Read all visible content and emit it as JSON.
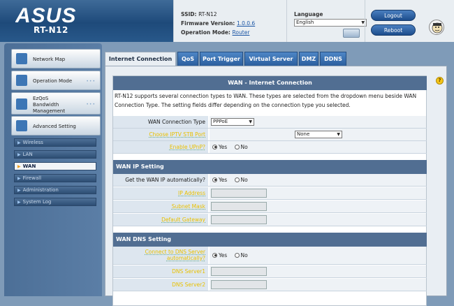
{
  "header": {
    "logo_text": "ASUS",
    "model": "RT-N12",
    "ssid_label": "SSID:",
    "ssid_value": "RT-N12",
    "firmware_label": "Firmware Version:",
    "firmware_value": "1.0.0.6",
    "mode_label": "Operation Mode:",
    "mode_value": "Router",
    "language_label": "Language",
    "language_value": "English",
    "logout_label": "Logout",
    "reboot_label": "Reboot"
  },
  "sidebar": {
    "main_items": [
      {
        "label": "Network Map",
        "icon": "network-map-icon"
      },
      {
        "label": "Operation Mode",
        "icon": "operation-mode-icon"
      },
      {
        "label": "EzQoS Bandwidth Management",
        "icon": "ezqos-icon"
      },
      {
        "label": "Advanced Setting",
        "icon": "advanced-setting-icon"
      }
    ],
    "sub_items": [
      {
        "label": "Wireless",
        "active": false
      },
      {
        "label": "LAN",
        "active": false
      },
      {
        "label": "WAN",
        "active": true
      },
      {
        "label": "Firewall",
        "active": false
      },
      {
        "label": "Administration",
        "active": false
      },
      {
        "label": "System Log",
        "active": false
      }
    ]
  },
  "tabs": [
    "Internet Connection",
    "QoS",
    "Port Trigger",
    "Virtual Server",
    "DMZ",
    "DDNS"
  ],
  "panel": {
    "title": "WAN - Internet Connection",
    "intro": "RT-N12 supports several connection types to WAN. These types are selected from the dropdown menu beside WAN Connection Type. The setting fields differ depending on the connection type you selected.",
    "wan_type_label": "WAN Connection Type",
    "wan_type_value": "PPPoE",
    "iptv_label": "Choose IPTV STB Port",
    "iptv_value": "None",
    "upnp_label": "Enable UPnP?",
    "yes": "Yes",
    "no": "No",
    "wan_ip_section": "WAN IP Setting",
    "auto_ip_label": "Get the WAN IP automatically?",
    "ip_label": "IP Address",
    "mask_label": "Subnet Mask",
    "gateway_label": "Default Gateway",
    "dns_section": "WAN DNS Setting",
    "dns_auto_label_1": "Connect to DNS Server",
    "dns_auto_label_2": "automatically?",
    "dns1_label": "DNS Server1",
    "dns2_label": "DNS Server2"
  },
  "colors": {
    "accent": "#516e92",
    "highlight_label": "#e8c000",
    "help_icon": "#f5c518"
  }
}
